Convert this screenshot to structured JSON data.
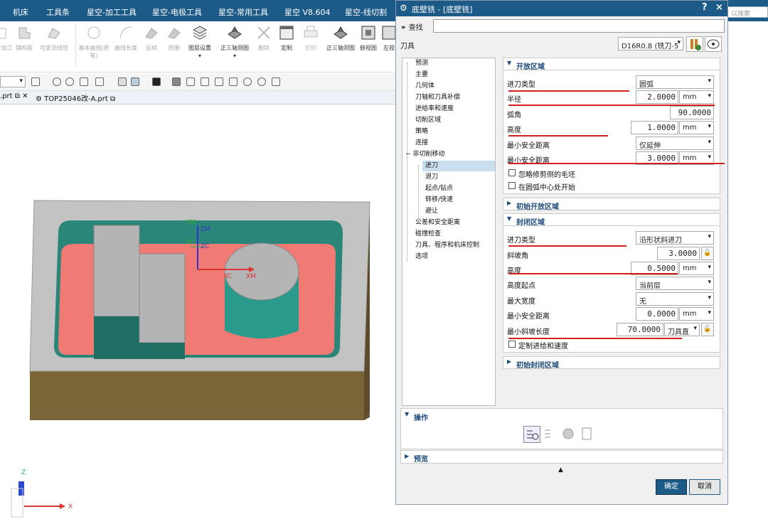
{
  "menubar": {
    "items": [
      "机床",
      "工具条",
      "星空-加工工具",
      "星空-电极工具",
      "星空-常用工具",
      "星空 V8.604",
      "星空-线切割"
    ],
    "search_placeholder": "以搜索"
  },
  "ribbon": {
    "buttons": [
      "基本曲线(原有)",
      "曲线长度",
      "延续",
      "附删",
      "图层设置",
      "正三轴测图",
      "删除",
      "定制",
      "打印",
      "正三轴测图",
      "俯视图",
      "左视"
    ],
    "left_labels": [
      "部件加工",
      "铺构面",
      "可变流线铣"
    ]
  },
  "file_tabs": [
    ".prt",
    "TOP25046改-A.prt"
  ],
  "viewport": {
    "labels": {
      "xm": "XM",
      "xc": "XC",
      "ym": "YM",
      "yc": "YC",
      "zm": "ZM",
      "zc": "ZC"
    },
    "triad": {
      "z": "Z",
      "x": "X"
    }
  },
  "dialog": {
    "title": "底壁铣 - [底壁铣]",
    "help": "?",
    "close": "×",
    "find_label": "查找",
    "tool_label": "刀具",
    "tool_value": "D16R0.8 (铣刀-5",
    "tree": [
      "预测",
      "主要",
      "几何体",
      "刀轴和刀具补偿",
      "进给率和速度",
      "切削区域",
      "策略",
      "连接",
      "非切削移动",
      "进刀",
      "退刀",
      "起点/钻点",
      "转移/快速",
      "避让",
      "公差和安全距离",
      "碰撞检查",
      "刀具、程序和机床控制",
      "选项"
    ],
    "selected_tree": "进刀",
    "open_area": {
      "header": "开放区域",
      "rows": [
        {
          "label": "进刀类型",
          "value": "圆弧"
        },
        {
          "label": "半径",
          "value": "2.0000",
          "unit": "mm"
        },
        {
          "label": "弧角",
          "value": "90.0000"
        },
        {
          "label": "高度",
          "value": "1.0000",
          "unit": "mm"
        },
        {
          "label": "最小安全距离",
          "value": "仅延伸"
        },
        {
          "label": "最小安全距离",
          "value": "3.0000",
          "unit": "mm"
        }
      ],
      "checks": [
        "忽略修剪侧的毛坯",
        "在圆弧中心处开始"
      ]
    },
    "initial_open": "初始开放区域",
    "closed_area": {
      "header": "封闭区域",
      "rows": [
        {
          "label": "进刀类型",
          "value": "沿形状斜进刀"
        },
        {
          "label": "斜坡角",
          "value": "3.0000"
        },
        {
          "label": "高度",
          "value": "0.5000",
          "unit": "mm"
        },
        {
          "label": "高度起点",
          "value": "当前层"
        },
        {
          "label": "最大宽度",
          "value": "无"
        },
        {
          "label": "最小安全距离",
          "value": "0.0000",
          "unit": "mm"
        },
        {
          "label": "最小斜坡长度",
          "value": "70.0000",
          "unit": "刀具直"
        }
      ],
      "checks": [
        "定制进给和速度"
      ]
    },
    "initial_closed": "初始封闭区域",
    "operations": "操作",
    "preview": "预览",
    "ok": "确定",
    "cancel": "取消"
  },
  "colors": {
    "accent": "#1c5a88",
    "red_annotation": "#d62020",
    "floor": "#f07a74",
    "wall": "#2b8a80",
    "block": "#b4b4b4"
  }
}
